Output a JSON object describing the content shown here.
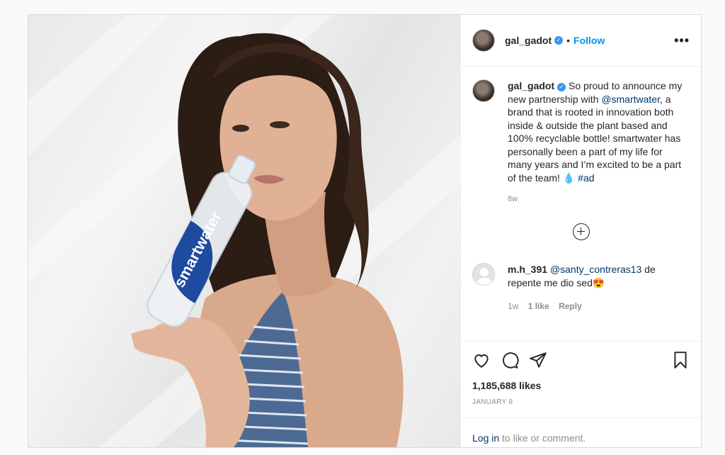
{
  "post": {
    "username": "gal_gadot",
    "verified_icon": "verified-badge-icon",
    "dot": "•",
    "follow_label": "Follow",
    "more_label": "•••",
    "caption_text": "So proud to announce my new partnership with",
    "caption_mention": "@smartwater",
    "caption_rest": ", a brand that is rooted in innovation both inside & outside the plant based and 100% recyclable bottle! smartwater has personally been a part of my life for many years and I’m excited to be a part of the team! 💧",
    "caption_hashtag": "#ad",
    "caption_time": "8w",
    "bottle_brand": "smartwater",
    "comment": {
      "username": "m.h_391",
      "mention": "@santy_contreras13",
      "text": " de repente me dio sed😍",
      "time": "1w",
      "likes": "1 like",
      "reply": "Reply"
    },
    "likes_count": "1,185,688 likes",
    "date": "JANUARY 8",
    "login_link": "Log in",
    "login_rest": " to like or comment."
  }
}
